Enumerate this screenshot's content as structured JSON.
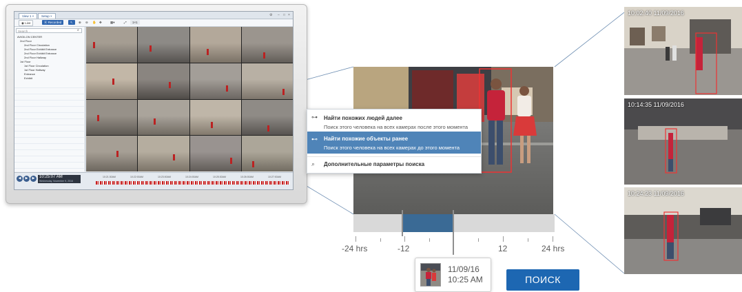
{
  "mini_ui": {
    "tabs": [
      "View 1 ×",
      "Setup ×"
    ],
    "toolbar": {
      "live_label": "Live",
      "recorded_label": "Recorded"
    },
    "search_placeholder": "Search...",
    "tree": [
      "AVIGILON CENTER",
      "2nd Floor",
      "2nd Floor Circulation",
      "2nd Floor Exhibit Entrance",
      "2nd Floor Exhibit Entrance",
      "2nd Floor Hallway",
      "1st Floor",
      "1st Floor Circulation",
      "1st Floor Hallway",
      "Entrance",
      "Exhibit"
    ],
    "playback_time": "10:25:07 AM",
    "playback_date": "Wednesday, November 9, 2016",
    "timeline_ticks": [
      "10:21:30AM",
      "10:22:00AM",
      "10:23:00AM",
      "10:24:00AM",
      "10:25:30AM",
      "10:26:00AM",
      "10:27:00AM"
    ]
  },
  "context_menu": {
    "items": [
      {
        "title": "Найти похожих людей далее",
        "subtitle": "Поиск этого человека на всех камерах после этого момента",
        "icon": "arrow-key-icon"
      },
      {
        "title": "Найти похожие объекты ранее",
        "subtitle": "Поиск этого человека на всех камерах до этого момента",
        "icon": "arrow-key-back-icon"
      },
      {
        "title": "Дополнительные параметры поиска",
        "icon": "search-icon"
      }
    ]
  },
  "timeline": {
    "labels": [
      "-24 hrs",
      "-12",
      "12",
      "24 hrs"
    ]
  },
  "callout": {
    "date": "11/09/16",
    "time": "10:25 AM"
  },
  "search_button": "ПОИСК",
  "results": [
    {
      "timestamp": "10:02:40  11/09/2016"
    },
    {
      "timestamp": "10:14:35  11/09/2016"
    },
    {
      "timestamp": "10:24:23  11/09/2016"
    }
  ],
  "colors": {
    "accent": "#1d67b2",
    "selection": "#3a6a95",
    "highlight": "#4f84b8",
    "detect": "#ee3333"
  }
}
